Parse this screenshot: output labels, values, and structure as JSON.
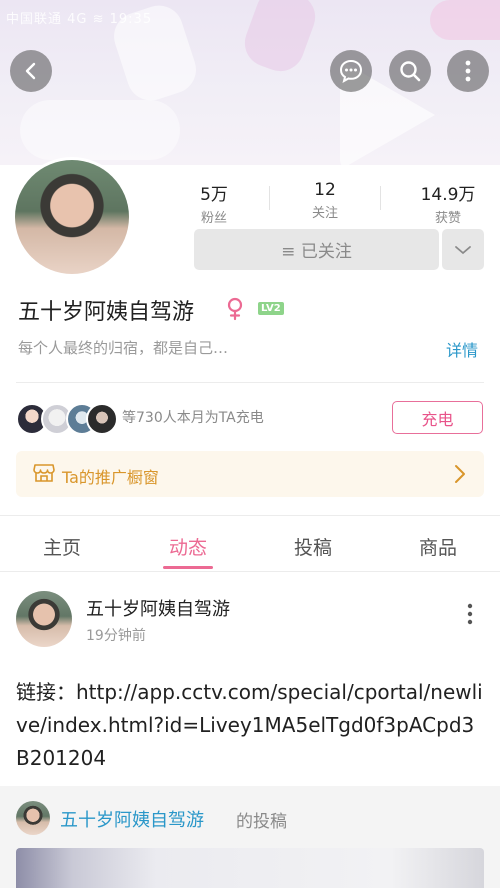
{
  "status_bar": {
    "text": "中国联通 4G ≋ 19:35"
  },
  "header": {
    "back_icon": "chevron-left-icon",
    "message_icon": "chat-bubble-icon",
    "search_icon": "search-icon",
    "more_icon": "more-vertical-icon"
  },
  "profile": {
    "stats": [
      {
        "value": "5万",
        "label": "粉丝"
      },
      {
        "value": "12",
        "label": "关注"
      },
      {
        "value": "14.9万",
        "label": "获赞"
      }
    ],
    "follow_button": "≡ 已关注",
    "name": "五十岁阿姨自驾游",
    "gender_icon": "female-icon",
    "level": "LV2",
    "signature": "每个人最终的归宿，都是自己…",
    "detail_link": "详情"
  },
  "charge": {
    "text": "等730人本月为TA充电",
    "button": "充电"
  },
  "shop": {
    "label": "Ta的推广橱窗"
  },
  "tabs": [
    {
      "label": "主页"
    },
    {
      "label": "动态"
    },
    {
      "label": "投稿"
    },
    {
      "label": "商品"
    }
  ],
  "post": {
    "author": "五十岁阿姨自驾游",
    "time": "19分钟前",
    "text": "链接：http://app.cctv.com/special/cportal/newlive/index.html?id=Livey1MA5elTgd0f3pACpd3B201204",
    "repost_author": "五十岁阿姨自驾游",
    "repost_suffix": "的投稿"
  },
  "colors": {
    "accent_pink": "#ec6a93",
    "link_blue": "#2a97c9",
    "shop_gold": "#d9962b"
  }
}
